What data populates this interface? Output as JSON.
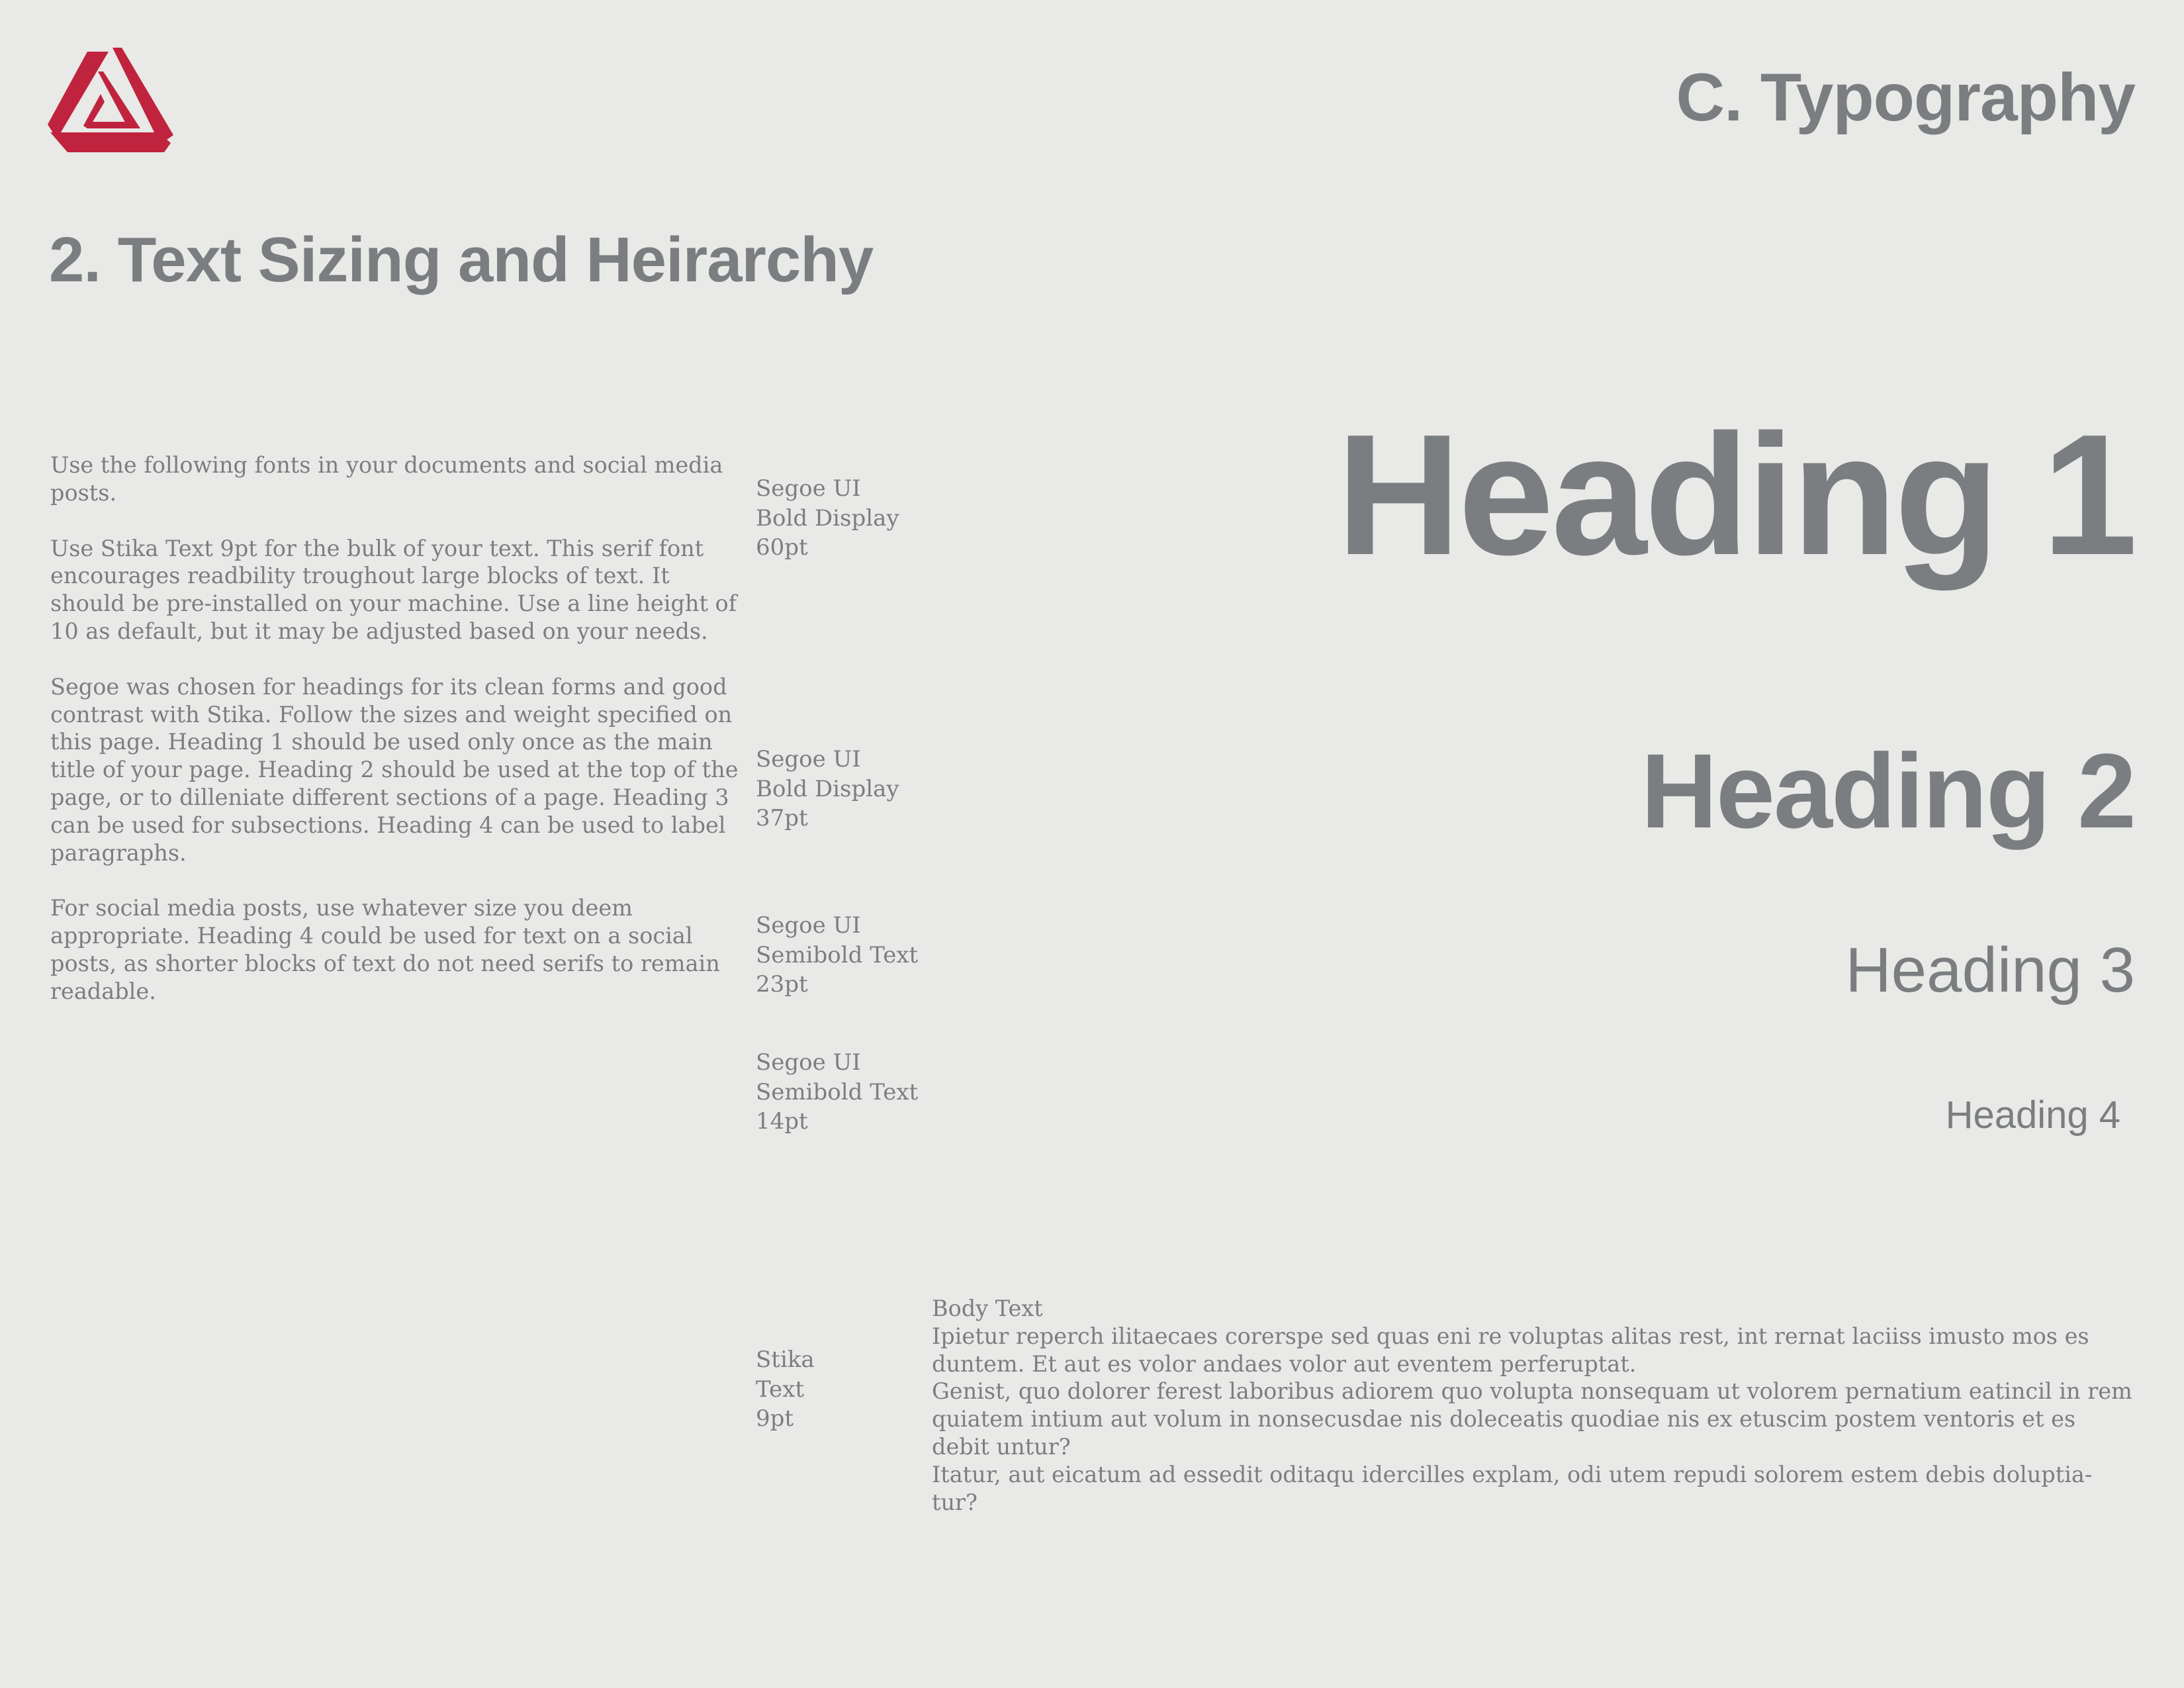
{
  "header": {
    "section_title": "C. Typography",
    "page_subtitle": "2. Text Sizing and Heirarchy",
    "logo_color": "#c0233e"
  },
  "intro_paragraphs": [
    "Use the following fonts in your documents and social media posts.",
    "Use Stika Text 9pt for the bulk of your text. This serif font encourages readbility troughout large blocks of text. It should be pre-installed on your machine. Use a line height of 10 as default, but it may be adjusted based on your needs.",
    "Segoe was chosen for headings for its clean forms and good contrast with Stika. Follow the sizes and weight specified on this page. Heading 1 should be used only once as the main title of your page. Heading 2 should be used at the top of the page, or to dilleniate different sections of a page. Heading 3 can be used for subsections. Heading 4 can be used to label paragraphs.",
    "For social media posts, use whatever size you deem appropriate.  Heading 4 could be used for text on a social posts, as shorter blocks of text do not need serifs to remain readable."
  ],
  "specs": [
    {
      "font": "Segoe UI",
      "weight": "Bold Display",
      "size": "60pt",
      "sample": "Heading 1"
    },
    {
      "font": "Segoe UI",
      "weight": "Bold Display",
      "size": "37pt",
      "sample": "Heading 2"
    },
    {
      "font": "Segoe UI",
      "weight": "Semibold Text",
      "size": "23pt",
      "sample": "Heading 3"
    },
    {
      "font": "Segoe UI",
      "weight": "Semibold Text",
      "size": "14pt",
      "sample": "Heading 4"
    }
  ],
  "body_spec": {
    "font": "Stika",
    "weight": "Text",
    "size": "9pt"
  },
  "body_sample": {
    "label": "Body Text",
    "paragraphs": [
      "Ipietur reperch ilitaecaes corerspe sed quas eni re voluptas alitas rest, int rernat laciiss imusto mos es duntem. Et aut es volor andaes volor aut eventem perferuptat.",
      "Genist, quo dolorer ferest laboribus adiorem quo volupta nonsequam ut volorem pernatium eatincil in rem quiatem intium aut volum in nonsecusdae nis doleceatis quodiae nis ex etuscim postem ventoris et es debit untur?",
      "Itatur, aut eicatum ad essedit oditaqu idercilles explam, odi utem repudi solorem estem debis doluptia-tur?"
    ]
  }
}
